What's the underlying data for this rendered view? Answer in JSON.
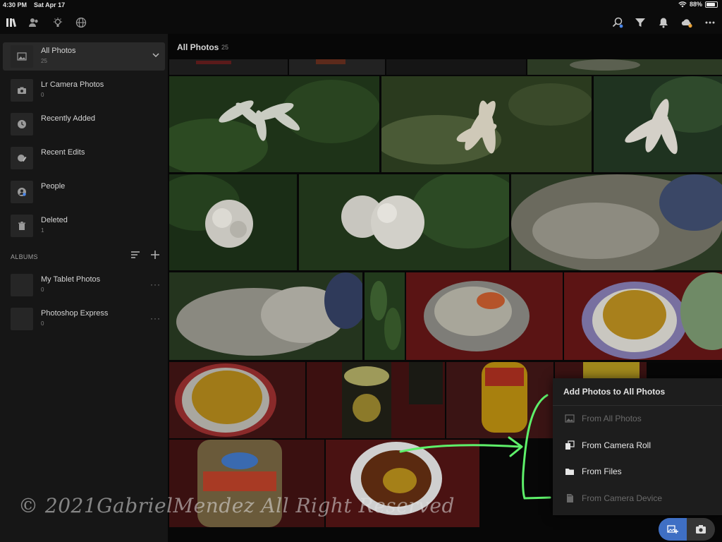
{
  "status": {
    "time": "4:30 PM",
    "date": "Sat Apr 17",
    "battery": "88%",
    "battery_level": 0.88
  },
  "sidebar": {
    "items": [
      {
        "label": "All Photos",
        "count": "25",
        "icon": "photos-icon",
        "selected": true
      },
      {
        "label": "Lr Camera Photos",
        "count": "0",
        "icon": "camera-icon"
      },
      {
        "label": "Recently Added",
        "count": "",
        "icon": "clock-icon"
      },
      {
        "label": "Recent Edits",
        "count": "",
        "icon": "edit-icon"
      },
      {
        "label": "People",
        "count": "",
        "icon": "people-icon"
      },
      {
        "label": "Deleted",
        "count": "1",
        "icon": "trash-icon"
      }
    ],
    "albums_header": "ALBUMS",
    "albums": [
      {
        "label": "My Tablet Photos",
        "count": "0"
      },
      {
        "label": "Photoshop Express",
        "count": "0"
      }
    ]
  },
  "main": {
    "title": "All Photos",
    "count": "25"
  },
  "watermark": "© 2021GabrielMendez All Right Reserved",
  "menu": {
    "title": "Add Photos to All Photos",
    "items": [
      {
        "label": "From All Photos",
        "icon": "image-icon",
        "enabled": false
      },
      {
        "label": "From Camera Roll",
        "icon": "camera-roll-icon",
        "enabled": true
      },
      {
        "label": "From Files",
        "icon": "folder-icon",
        "enabled": true
      },
      {
        "label": "From Camera Device",
        "icon": "sd-card-icon",
        "enabled": false
      }
    ]
  },
  "colors": {
    "accent": "#3f6fc4",
    "annotation": "#5ef06a"
  }
}
